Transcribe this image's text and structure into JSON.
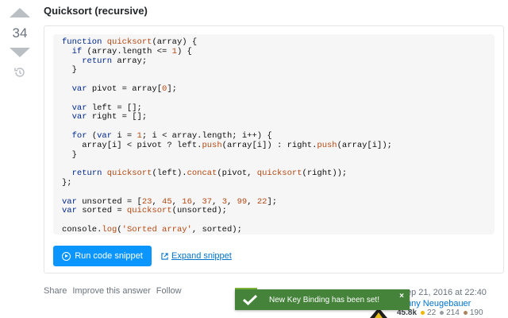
{
  "vote": {
    "score": "34"
  },
  "answer": {
    "heading": "Quicksort (recursive)",
    "code_lines": [
      "function quicksort(array) {",
      "  if (array.length <= 1) {",
      "    return array;",
      "  }",
      "",
      "  var pivot = array[0];",
      "",
      "  var left = [];",
      "  var right = [];",
      "",
      "  for (var i = 1; i < array.length; i++) {",
      "    array[i] < pivot ? left.push(array[i]) : right.push(array[i]);",
      "  }",
      "",
      "  return quicksort(left).concat(pivot, quicksort(right));",
      "};",
      "",
      "var unsorted = [23, 45, 16, 37, 3, 99, 22];",
      "var sorted = quicksort(unsorted);",
      "",
      "console.log('Sorted array', sorted);"
    ],
    "run_label": "Run code snippet",
    "expand_label": "Expand snippet"
  },
  "post_actions": {
    "share": "Share",
    "improve": "Improve this answer",
    "follow": "Follow"
  },
  "signature": {
    "date": "ep 21, 2016 at 22:40",
    "name": "nny Neugebauer",
    "reputation": "45.8k",
    "gold": "22",
    "silver": "214",
    "bronze": "190"
  },
  "toast": {
    "message": "New Key Binding has been set!",
    "close": "×"
  },
  "colors": {
    "accent": "#0a95ff",
    "toast": "#45833a",
    "link": "#0074cc"
  }
}
